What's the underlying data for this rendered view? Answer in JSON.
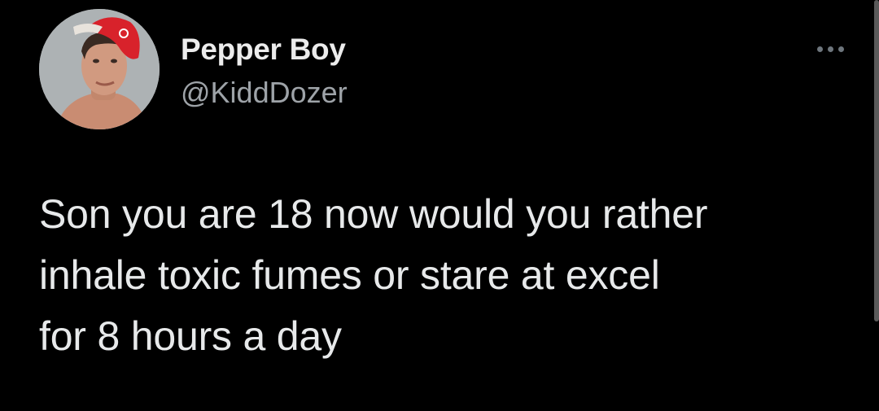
{
  "author": {
    "display_name": "Pepper Boy",
    "handle": "@KiddDozer",
    "avatar_icon": "profile-photo-red-cap"
  },
  "more_icon": "more-options-icon",
  "tweet": {
    "lines": [
      "Son you are 18 now would you rather",
      "inhale toxic fumes or stare at excel",
      "for 8 hours a day"
    ]
  },
  "colors": {
    "background": "#000000",
    "text_primary": "#e7e9ea",
    "text_secondary": "#9ea3a8",
    "cap_red": "#d8222b"
  }
}
